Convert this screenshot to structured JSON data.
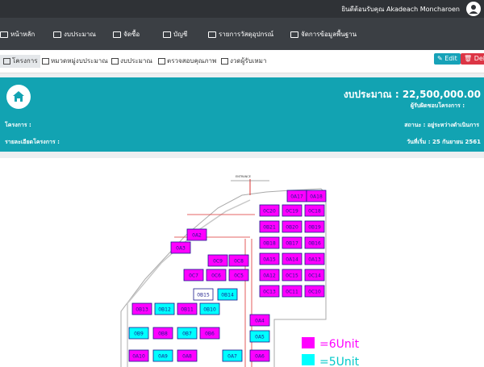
{
  "topbar": {
    "welcome": "ยินดีต้อนรับคุณ Akadeach Moncharoen"
  },
  "nav": {
    "items": [
      {
        "label": "หน้าหลัก"
      },
      {
        "label": "งบประมาณ"
      },
      {
        "label": "จัดซื้อ"
      },
      {
        "label": "บัญชี"
      },
      {
        "label": "รายการวัสดุอุปกรณ์"
      },
      {
        "label": "จัดการข้อมูลพื้นฐาน"
      }
    ]
  },
  "tabs": [
    {
      "label": "โครงการ"
    },
    {
      "label": "หมวดหมู่งบประมาณ"
    },
    {
      "label": "งบประมาณ"
    },
    {
      "label": "ตรวจสอบคุณภาพ"
    },
    {
      "label": "งวดผู้รับเหมา"
    }
  ],
  "actions": {
    "edit": "Edit",
    "delete": "Delete"
  },
  "project": {
    "budget": "งบประมาณ : 22,500,000.00",
    "responsible": "ผู้รับผิดชอบโครงการ :",
    "project_label": "โครงการ :",
    "status": "สถานะ : อยู่ระหว่างดำเนินการ",
    "detail_label": "รายละเอียดโครงการ :",
    "start_date": "วันที่เริ่ม : 25 กันยายน 2561"
  },
  "legend": [
    {
      "label": "=6Unit",
      "color": "#ff00ff"
    },
    {
      "label": "=5Unit",
      "color": "#00ffff"
    }
  ],
  "plan_labels": [
    "0A17",
    "0A18",
    "0C20",
    "0C19",
    "0C18",
    "0B21",
    "0B20",
    "0B19",
    "0B18",
    "0B17",
    "0B16",
    "0A15",
    "0A14",
    "0A13",
    "0A12",
    "0C15",
    "0C14",
    "0C13",
    "0C11",
    "0C10",
    "0C9",
    "0C8",
    "0C7",
    "0C6",
    "0C5",
    "0B15",
    "0B14",
    "0B13",
    "0B12",
    "0B11",
    "0B10",
    "0B9",
    "0B8",
    "0B7",
    "0B6",
    "0A10",
    "0A9",
    "0A8",
    "0A7",
    "0A6",
    "0A5",
    "0A4",
    "0A3",
    "0A2"
  ]
}
